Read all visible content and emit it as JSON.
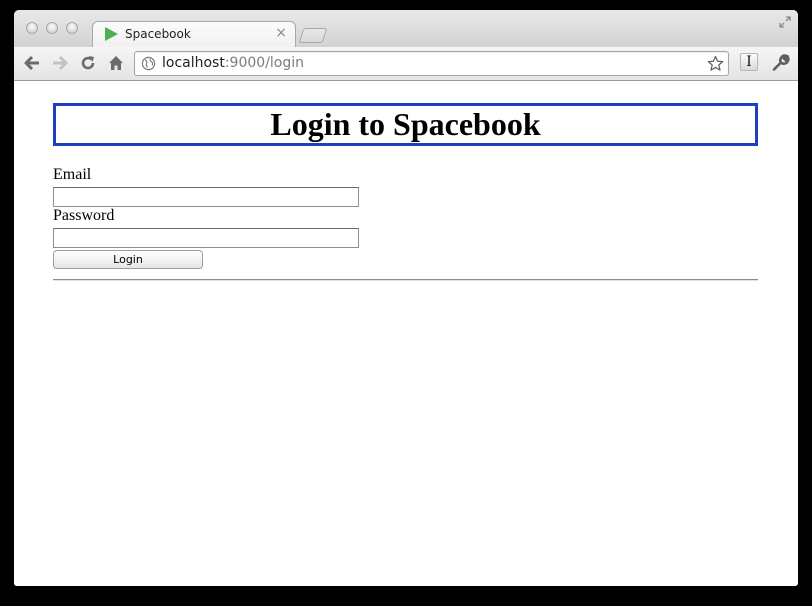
{
  "browser": {
    "tab": {
      "title": "Spacebook",
      "close_glyph": "×"
    },
    "address_bar": {
      "host": "localhost",
      "rest": ":9000/login"
    },
    "extension_label": "I",
    "icons": {
      "favicon": "play-triangle-icon",
      "back": "back-arrow-icon",
      "forward": "forward-arrow-icon",
      "reload": "reload-icon",
      "home": "home-icon",
      "site": "globe-icon",
      "bookmark": "star-icon",
      "menu": "wrench-icon",
      "fullscreen": "resize-icon"
    },
    "colors": {
      "favicon": "#4caf50"
    }
  },
  "page": {
    "heading": "Login to Spacebook",
    "email_label": "Email",
    "email_value": "",
    "password_label": "Password",
    "password_value": "",
    "login_button": "Login",
    "colors": {
      "heading_border": "#1e3fbf"
    }
  }
}
